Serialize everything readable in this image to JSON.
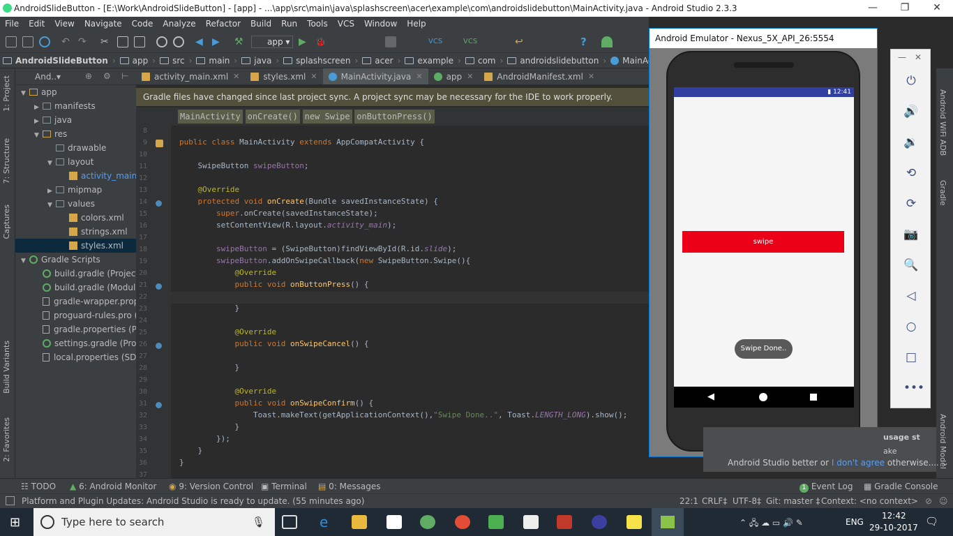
{
  "window_title": "AndroidSlideButton - [E:\\Work\\AndroidSlideButton] - [app] - ...\\app\\src\\main\\java\\splashscreen\\acer\\example\\com\\androidslidebutton\\MainActivity.java - Android Studio 2.3.3",
  "window_controls": {
    "minimize": "—",
    "maximize": "❐",
    "close": "✕"
  },
  "menu": [
    "File",
    "Edit",
    "View",
    "Navigate",
    "Code",
    "Analyze",
    "Refactor",
    "Build",
    "Run",
    "Tools",
    "VCS",
    "Window",
    "Help"
  ],
  "toolbar": {
    "run_config": "app"
  },
  "nav_crumbs": [
    "AndroidSlideButton",
    "app",
    "src",
    "main",
    "java",
    "splashscreen",
    "acer",
    "example",
    "com",
    "androidslidebutton",
    "MainActivity"
  ],
  "project_header": "And..▾",
  "tree": [
    {
      "label": "app",
      "type": "folder",
      "indent": 0,
      "arrow": "▼"
    },
    {
      "label": "manifests",
      "type": "folder",
      "indent": 1,
      "arrow": "▶"
    },
    {
      "label": "java",
      "type": "folder",
      "indent": 1,
      "arrow": "▶"
    },
    {
      "label": "res",
      "type": "folder",
      "indent": 1,
      "arrow": "▼"
    },
    {
      "label": "drawable",
      "type": "folder",
      "indent": 2,
      "arrow": ""
    },
    {
      "label": "layout",
      "type": "folder",
      "indent": 2,
      "arrow": "▼"
    },
    {
      "label": "activity_main",
      "type": "xml",
      "indent": 3,
      "arrow": ""
    },
    {
      "label": "mipmap",
      "type": "folder",
      "indent": 2,
      "arrow": "▶"
    },
    {
      "label": "values",
      "type": "folder",
      "indent": 2,
      "arrow": "▼"
    },
    {
      "label": "colors.xml",
      "type": "xml",
      "indent": 3,
      "arrow": ""
    },
    {
      "label": "strings.xml",
      "type": "xml",
      "indent": 3,
      "arrow": ""
    },
    {
      "label": "styles.xml",
      "type": "xml",
      "indent": 3,
      "arrow": "",
      "selected": true
    },
    {
      "label": "Gradle Scripts",
      "type": "gradle",
      "indent": 0,
      "arrow": "▼"
    },
    {
      "label": "build.gradle (Project:",
      "type": "gradle",
      "indent": 1,
      "arrow": ""
    },
    {
      "label": "build.gradle (Module",
      "type": "gradle",
      "indent": 1,
      "arrow": ""
    },
    {
      "label": "gradle-wrapper.prope",
      "type": "file",
      "indent": 1,
      "arrow": ""
    },
    {
      "label": "proguard-rules.pro (P",
      "type": "file",
      "indent": 1,
      "arrow": ""
    },
    {
      "label": "gradle.properties (Pro",
      "type": "file",
      "indent": 1,
      "arrow": ""
    },
    {
      "label": "settings.gradle (Proje",
      "type": "gradle",
      "indent": 1,
      "arrow": ""
    },
    {
      "label": "local.properties (SDK",
      "type": "file",
      "indent": 1,
      "arrow": ""
    }
  ],
  "tabs": [
    {
      "label": "activity_main.xml",
      "active": false
    },
    {
      "label": "styles.xml",
      "active": false
    },
    {
      "label": "MainActivity.java",
      "active": true
    },
    {
      "label": "app",
      "active": false
    },
    {
      "label": "AndroidManifest.xml",
      "active": false
    }
  ],
  "banner": "Gradle files have changed since last project sync. A project sync may be necessary for the IDE to work properly.",
  "code_crumbs": [
    "MainActivity",
    "onCreate()",
    "new Swipe",
    "onButtonPress()"
  ],
  "line_numbers": [
    "8",
    "9",
    "10",
    "11",
    "12",
    "13",
    "14",
    "15",
    "16",
    "17",
    "18",
    "19",
    "20",
    "21",
    "22",
    "23",
    "24",
    "25",
    "26",
    "27",
    "28",
    "29",
    "30",
    "31",
    "32",
    "33",
    "34",
    "35",
    "36",
    "37"
  ],
  "code_lines": [
    "",
    "<k>public class</k> MainActivity <k>extends</k> AppCompatActivity {",
    "",
    "    SwipeButton <f>swipeButton</f>;",
    "",
    "    <a>@Override</a>",
    "    <k>protected void</k> <m>onCreate</m>(Bundle savedInstanceState) {",
    "        <k>super</k>.onCreate(savedInstanceState);",
    "        setContentView(R.layout.<fi>activity_main</fi>);",
    "",
    "        <f>swipeButton</f> = (SwipeButton)findViewById(R.id.<fi>slide</fi>);",
    "        <f>swipeButton</f>.addOnSwipeCallback(<k>new</k> SwipeButton.Swipe(){",
    "            <a>@Override</a>",
    "            <k>public void</k> <m>onButtonPress</m>() {",
    "",
    "            }",
    "",
    "            <a>@Override</a>",
    "            <k>public void</k> <m>onSwipeCancel</m>() {",
    "",
    "            }",
    "",
    "            <a>@Override</a>",
    "            <k>public void</k> <m>onSwipeConfirm</m>() {",
    "                Toast.makeText(getApplicationContext(),<s>\"Swipe Done..\"</s>, Toast.<fi>LENGTH_LONG</fi>).show();",
    "            }",
    "        });",
    "    }",
    "}",
    ""
  ],
  "emulator": {
    "title": "Android Emulator - Nexus_5X_API_26:5554",
    "clock": "12:41",
    "button_label": "swipe",
    "toast": "Swipe Done..",
    "controls": [
      "⏻",
      "🔊",
      "🔉",
      "⟲",
      "⟳",
      "📷",
      "🔍",
      "◁",
      "○",
      "□",
      "•••"
    ],
    "win_min": "—",
    "win_close": "✕"
  },
  "notification": {
    "line1": "usage st",
    "line2": "ake",
    "line3_a": "Android Studio better or ",
    "line3_link": "I don't agree",
    "line3_b": " otherwise...."
  },
  "left_strip": [
    "1: Project",
    "7: Structure",
    "Captures",
    "Build Variants",
    "2: Favorites"
  ],
  "right_strip": [
    "Android WiFi ADB",
    "Gradle",
    "Android Model"
  ],
  "bottom_tools": [
    "TODO",
    "6: Android Monitor",
    "9: Version Control",
    "Terminal",
    "0: Messages",
    "Event Log",
    "Gradle Console"
  ],
  "event_badge": "1",
  "status": {
    "message": "Platform and Plugin Updates: Android Studio is ready to update. (55 minutes ago)",
    "pos": "22:1",
    "crlf": "CRLF‡",
    "enc": "UTF-8‡",
    "git": "Git: master ‡",
    "context": "Context: <no context>"
  },
  "taskbar": {
    "search_placeholder": "Type here to search",
    "lang": "ENG",
    "time": "12:42",
    "date": "29-10-2017"
  },
  "colors": {
    "keyword": "#cc7832",
    "annotation": "#bbb529",
    "method": "#ffc66d",
    "field": "#9876aa",
    "string": "#6a8759",
    "swipe_button": "#ec0017",
    "status_bar": "#303f9f"
  }
}
